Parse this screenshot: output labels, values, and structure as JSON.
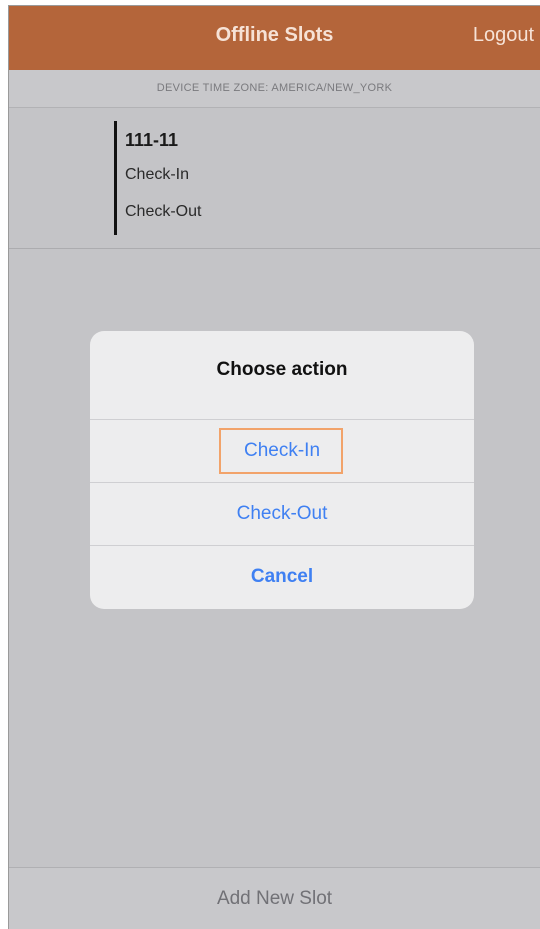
{
  "navbar": {
    "title": "Offline Slots",
    "logout_label": "Logout"
  },
  "timezone": {
    "text": "DEVICE TIME ZONE: AMERICA/NEW_YORK"
  },
  "slot": {
    "name": "111-11",
    "line1": "Check-In",
    "line2": "Check-Out"
  },
  "dialog": {
    "title": "Choose action",
    "actions": [
      {
        "label": "Check-In"
      },
      {
        "label": "Check-Out"
      },
      {
        "label": "Cancel"
      }
    ]
  },
  "footer": {
    "add_label": "Add New Slot"
  },
  "colors": {
    "navbar": "#b4653a",
    "action_blue": "#3f80f2",
    "highlight_border": "#f2a36a"
  }
}
